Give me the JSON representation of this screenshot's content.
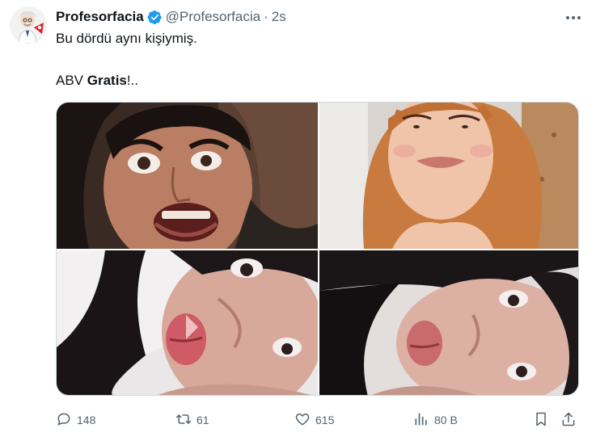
{
  "tweet": {
    "display_name": "Profesorfacia",
    "handle": "@Profesorfacia",
    "separator": "·",
    "time": "2s",
    "text_line1": "Bu dördü aynı kişiymiş.",
    "text_line2_prefix": "ABV ",
    "text_line2_bold": "Gratis",
    "text_line2_suffix": "!.."
  },
  "media": {
    "photos": [
      {
        "name": "angry-woman-photo"
      },
      {
        "name": "redhead-woman-photo"
      },
      {
        "name": "dark-hair-woman-photo"
      },
      {
        "name": "dark-hair-woman-lying-photo"
      }
    ]
  },
  "actions": {
    "replies": "148",
    "retweets": "61",
    "likes": "615",
    "views": "80 B"
  },
  "icons": {
    "verified": "verified-badge-icon",
    "more": "more-icon",
    "reply": "reply-icon",
    "retweet": "retweet-icon",
    "like": "heart-icon",
    "views": "views-icon",
    "bookmark": "bookmark-icon",
    "share": "share-icon"
  },
  "colors": {
    "verified": "#1d9bf0",
    "muted": "#536471",
    "text": "#0f1419"
  }
}
